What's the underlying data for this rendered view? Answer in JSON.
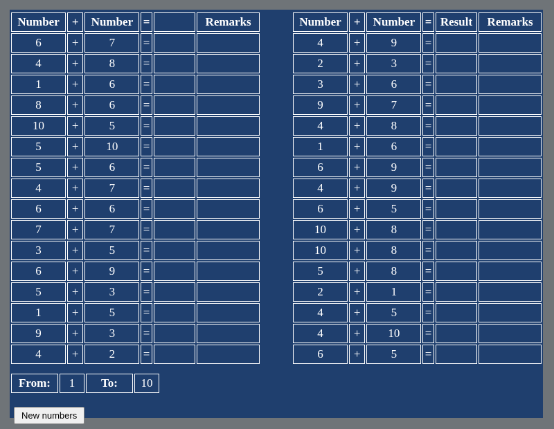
{
  "headers": {
    "number": "Number",
    "plus": "+",
    "equals": "=",
    "result": "Result",
    "remarks": "Remarks"
  },
  "left_rows": [
    {
      "a": "6",
      "op": "+",
      "b": "7",
      "eq": "=",
      "res": "",
      "rem": ""
    },
    {
      "a": "4",
      "op": "+",
      "b": "8",
      "eq": "=",
      "res": "",
      "rem": ""
    },
    {
      "a": "1",
      "op": "+",
      "b": "6",
      "eq": "=",
      "res": "",
      "rem": ""
    },
    {
      "a": "8",
      "op": "+",
      "b": "6",
      "eq": "=",
      "res": "",
      "rem": ""
    },
    {
      "a": "10",
      "op": "+",
      "b": "5",
      "eq": "=",
      "res": "",
      "rem": ""
    },
    {
      "a": "5",
      "op": "+",
      "b": "10",
      "eq": "=",
      "res": "",
      "rem": ""
    },
    {
      "a": "5",
      "op": "+",
      "b": "6",
      "eq": "=",
      "res": "",
      "rem": ""
    },
    {
      "a": "4",
      "op": "+",
      "b": "7",
      "eq": "=",
      "res": "",
      "rem": ""
    },
    {
      "a": "6",
      "op": "+",
      "b": "6",
      "eq": "=",
      "res": "",
      "rem": ""
    },
    {
      "a": "7",
      "op": "+",
      "b": "7",
      "eq": "=",
      "res": "",
      "rem": ""
    },
    {
      "a": "3",
      "op": "+",
      "b": "5",
      "eq": "=",
      "res": "",
      "rem": ""
    },
    {
      "a": "6",
      "op": "+",
      "b": "9",
      "eq": "=",
      "res": "",
      "rem": ""
    },
    {
      "a": "5",
      "op": "+",
      "b": "3",
      "eq": "=",
      "res": "",
      "rem": ""
    },
    {
      "a": "1",
      "op": "+",
      "b": "5",
      "eq": "=",
      "res": "",
      "rem": ""
    },
    {
      "a": "9",
      "op": "+",
      "b": "3",
      "eq": "=",
      "res": "",
      "rem": ""
    },
    {
      "a": "4",
      "op": "+",
      "b": "2",
      "eq": "=",
      "res": "",
      "rem": ""
    }
  ],
  "right_rows": [
    {
      "a": "4",
      "op": "+",
      "b": "9",
      "eq": "=",
      "res": "",
      "rem": ""
    },
    {
      "a": "2",
      "op": "+",
      "b": "3",
      "eq": "=",
      "res": "",
      "rem": ""
    },
    {
      "a": "3",
      "op": "+",
      "b": "6",
      "eq": "=",
      "res": "",
      "rem": ""
    },
    {
      "a": "9",
      "op": "+",
      "b": "7",
      "eq": "=",
      "res": "",
      "rem": ""
    },
    {
      "a": "4",
      "op": "+",
      "b": "8",
      "eq": "=",
      "res": "",
      "rem": ""
    },
    {
      "a": "1",
      "op": "+",
      "b": "6",
      "eq": "=",
      "res": "",
      "rem": ""
    },
    {
      "a": "6",
      "op": "+",
      "b": "9",
      "eq": "=",
      "res": "",
      "rem": ""
    },
    {
      "a": "4",
      "op": "+",
      "b": "9",
      "eq": "=",
      "res": "",
      "rem": ""
    },
    {
      "a": "6",
      "op": "+",
      "b": "5",
      "eq": "=",
      "res": "",
      "rem": ""
    },
    {
      "a": "10",
      "op": "+",
      "b": "8",
      "eq": "=",
      "res": "",
      "rem": ""
    },
    {
      "a": "10",
      "op": "+",
      "b": "8",
      "eq": "=",
      "res": "",
      "rem": ""
    },
    {
      "a": "5",
      "op": "+",
      "b": "8",
      "eq": "=",
      "res": "",
      "rem": ""
    },
    {
      "a": "2",
      "op": "+",
      "b": "1",
      "eq": "=",
      "res": "",
      "rem": ""
    },
    {
      "a": "4",
      "op": "+",
      "b": "5",
      "eq": "=",
      "res": "",
      "rem": ""
    },
    {
      "a": "4",
      "op": "+",
      "b": "10",
      "eq": "=",
      "res": "",
      "rem": ""
    },
    {
      "a": "6",
      "op": "+",
      "b": "5",
      "eq": "=",
      "res": "",
      "rem": ""
    }
  ],
  "range": {
    "from_label": "From:",
    "from_value": "1",
    "to_label": "To:",
    "to_value": "10"
  },
  "buttons": {
    "new_numbers": "New numbers"
  }
}
